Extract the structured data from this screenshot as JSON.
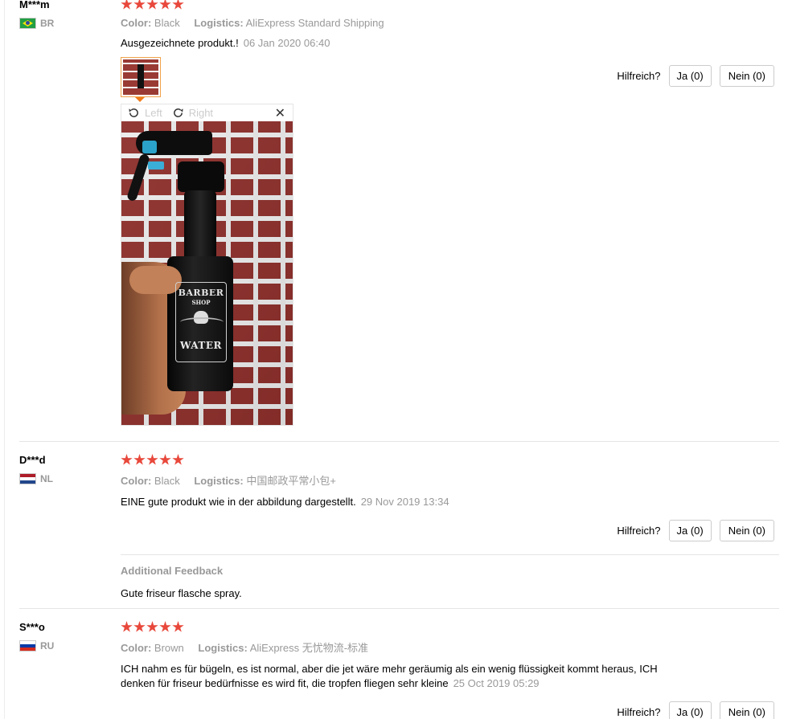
{
  "reviews": [
    {
      "user": "M***m",
      "country": "BR",
      "stars": 5,
      "color_label": "Color:",
      "color_value": "Black",
      "logistics_label": "Logistics:",
      "logistics_value": "AliExpress Standard Shipping",
      "text": "Ausgezeichnete produkt.!",
      "date": "06 Jan 2020 06:40",
      "helpful_label": "Hilfreich?",
      "yes_label": "Ja (0)",
      "no_label": "Nein (0)",
      "viewer": {
        "rotate_left_label": "Left",
        "rotate_right_label": "Right",
        "close_symbol": "✕",
        "photo_label_line1": "BARBER",
        "photo_label_line2": "SHOP",
        "photo_label_line3": "WATER"
      }
    },
    {
      "user": "D***d",
      "country": "NL",
      "stars": 5,
      "color_label": "Color:",
      "color_value": "Black",
      "logistics_label": "Logistics:",
      "logistics_value": "中国邮政平常小包+",
      "text": "EINE gute produkt wie in der abbildung dargestellt.",
      "date": "29 Nov 2019 13:34",
      "helpful_label": "Hilfreich?",
      "yes_label": "Ja (0)",
      "no_label": "Nein (0)",
      "additional_title": "Additional Feedback",
      "additional_text": "Gute friseur flasche spray."
    },
    {
      "user": "S***o",
      "country": "RU",
      "stars": 5,
      "color_label": "Color:",
      "color_value": "Brown",
      "logistics_label": "Logistics:",
      "logistics_value": "AliExpress 无忧物流-标准",
      "text_line1": "ICH nahm es für bügeln, es ist normal, aber die jet wäre mehr geräumig als ein wenig flüssigkeit kommt heraus, ICH",
      "text_line2": "denken für friseur bedürfnisse es wird fit, die tropfen fliegen sehr kleine",
      "date": "25 Oct 2019 05:29",
      "helpful_label": "Hilfreich?",
      "yes_label": "Ja (0)",
      "no_label": "Nein (0)"
    }
  ],
  "colors": {
    "star": "#e8483b",
    "muted": "#999999",
    "thumb_border": "#f0a24a"
  }
}
